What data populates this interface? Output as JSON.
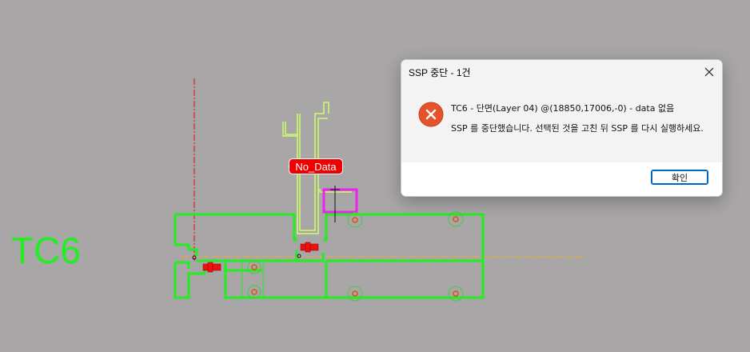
{
  "drawing": {
    "section_label": "TC6",
    "tag_label": "No_Data"
  },
  "dialog": {
    "title": "SSP 중단 - 1건",
    "message_line1": "TC6 - 단면(Layer 04) @(18850,17006,-0) - data 없음",
    "message_line2": "SSP 를 중단했습니다. 선택된 것을 고친 뒤 SSP 를 다시 실행하세요.",
    "ok_label": "확인",
    "icon": "error-icon"
  },
  "colors": {
    "background": "#a8a6a6",
    "profile": "#22ee22",
    "highlight": "#ccff66",
    "magenta": "#ee22ee",
    "error_red": "#e5532d",
    "accent": "#0067c0"
  }
}
